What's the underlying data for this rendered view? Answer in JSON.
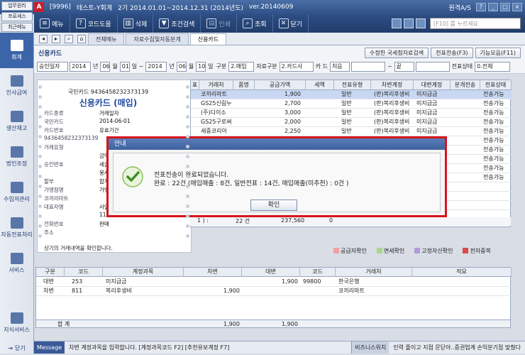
{
  "window": {
    "code": "[9996]",
    "company": "테스트-Y회계",
    "period": "2기 2014.01.01~2014.12.31 (2014년도)",
    "version": "ver.20140609",
    "as_label": "원격A/S",
    "logo": "A"
  },
  "quick": [
    "업무원리",
    "프로세스",
    "최근메뉴"
  ],
  "toolbar": {
    "menu": "메뉴",
    "help": "코드도움",
    "delete": "삭제",
    "search": "조건검색",
    "print": "인쇄",
    "view": "조회",
    "close": "닫기",
    "search_placeholder": "[F10] 를 누르세요"
  },
  "sidebar": [
    {
      "label": "회계",
      "active": true
    },
    {
      "label": "인사급여"
    },
    {
      "label": "생산재고"
    },
    {
      "label": "법인조정"
    },
    {
      "label": "수입저관리"
    },
    {
      "label": "자동전표처리"
    },
    {
      "label": "서비스"
    },
    {
      "label": "지식서비스"
    },
    {
      "label": "닫기"
    }
  ],
  "tabs": [
    "전체메뉴",
    "자료수집및자동분개",
    "신용카드"
  ],
  "page": {
    "title": "신용카드",
    "btn_national": "수정한 국세청자료검색",
    "btn_send": "전표전송(F3)",
    "btn_func": "기능모음(F11)"
  },
  "filter": {
    "date_type": "승인일자",
    "from_year": "2014",
    "from_month": "06",
    "from_day": "01",
    "to_year": "2014",
    "to_month": "06",
    "to_day": "10",
    "div_label": "구분",
    "div_value": "2.매입",
    "src_label": "자료구분",
    "src_value": "2.카드사",
    "card_label": "카 드",
    "card_from": "처음",
    "card_to": "끝",
    "slip_label": "전표상태",
    "slip_value": "0.전체"
  },
  "card": {
    "number": "국민카드 9436458232373139",
    "name": "신용카드 (매입)",
    "rows": [
      {
        "k": "카드종류",
        "v": "거래일자"
      },
      {
        "k": "국민카드",
        "v": "2014-06-01"
      },
      {
        "k": "카드번호",
        "v": "유효기간"
      },
      {
        "k": "9436458232373139",
        "v": ""
      },
      {
        "k": "거래유형",
        "v": ""
      },
      {
        "k": "",
        "v": "금액"
      },
      {
        "k": "승인번호",
        "v": "세금"
      },
      {
        "k": "",
        "v": "봉사"
      },
      {
        "k": "할부",
        "v": "합계"
      },
      {
        "k": "가맹점명",
        "v": "가맹"
      },
      {
        "k": "코끼리마트",
        "v": ""
      },
      {
        "k": "대표자명",
        "v": "사업"
      },
      {
        "k": "",
        "v": "11"
      },
      {
        "k": "전화번호",
        "v": "판매"
      },
      {
        "k": "주소",
        "v": ""
      }
    ],
    "footer": "상기의 거래내역을 확인합니다."
  },
  "grid": {
    "headers": [
      "표",
      "거래처",
      "품명",
      "공급가액",
      "세액",
      "전표유형",
      "차변계정",
      "대변계정",
      "분개전송",
      "전표상태"
    ],
    "rows": [
      {
        "vendor": "코끼리마트",
        "amt": "1,900",
        "type": "일반",
        "debit": "(판)복리후생비",
        "credit": "미지급금",
        "status": "전송가능"
      },
      {
        "vendor": "GS25신림누",
        "amt": "2,700",
        "type": "일반",
        "debit": "(판)복리후생비",
        "credit": "미지급금",
        "status": "전송가능"
      },
      {
        "vendor": "(주)디이소",
        "amt": "3,000",
        "type": "일반",
        "debit": "(판)복리후생비",
        "credit": "미지급금",
        "status": "전송가능"
      },
      {
        "vendor": "GS25구로써",
        "amt": "2,000",
        "type": "일반",
        "debit": "(판)복리후생비",
        "credit": "미지급금",
        "status": "전송가능"
      },
      {
        "vendor": "세중코리아",
        "amt": "2,250",
        "type": "일반",
        "debit": "(판)복리후생비",
        "credit": "미지급금",
        "status": "전송가능"
      }
    ],
    "extra_status": [
      "전송가능",
      "전송가능",
      "전송가능",
      "전송가능",
      "전송가능"
    ],
    "total_label": "1 ) :",
    "total_count": "22 건",
    "total_amt": "237,560",
    "total_tax": "0"
  },
  "legend": [
    {
      "label": "공급자확인",
      "color": "#f2a0a0"
    },
    {
      "label": "면세확인",
      "color": "#a6d98a"
    },
    {
      "label": "고정자산확인",
      "color": "#b49ad8"
    },
    {
      "label": "전자중복",
      "color": "#e04848"
    }
  ],
  "bottom": {
    "headers": [
      "구분",
      "코드",
      "계정과목",
      "차변",
      "대변",
      "코드",
      "거래처",
      "적요"
    ],
    "rows": [
      {
        "div": "대변",
        "code": "253",
        "account": "미지급금",
        "debit": "",
        "credit": "1,900",
        "vcode": "99800",
        "vendor": "한국은행",
        "memo": ""
      },
      {
        "div": "차변",
        "code": "811",
        "account": "복리후생비",
        "debit": "1,900",
        "credit": "",
        "vcode": "",
        "vendor": "코끼리마트",
        "memo": ""
      }
    ],
    "total_label": "합     계",
    "total_debit": "1,900",
    "total_credit": "1,900"
  },
  "status": {
    "msg_label": "Message",
    "msg": "차변 계정과목을 입력합니다. [계정과목코드 F2] [추천유보계정 F7]",
    "biz_label": "비즈니스위치",
    "biz": "인력 줄이고 지점 문닫아..증권업계 손익분기점 맞췄다"
  },
  "dialog": {
    "title": "안내",
    "line1": "전표전송이 완료되었습니다.",
    "line2": "완료 : 22건 (매입매출 : 8건, 일반전표 : 14건, 매입매출(미추천) : 0건 )",
    "ok": "확인"
  }
}
